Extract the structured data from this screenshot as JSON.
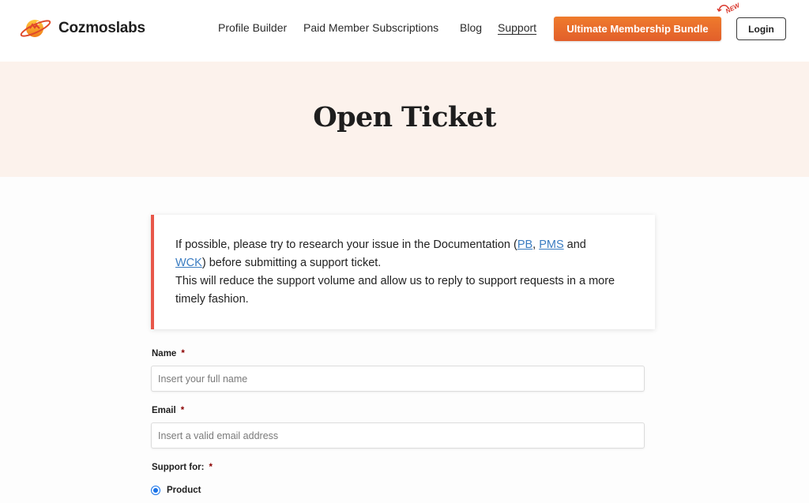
{
  "brand": {
    "name": "Cozmoslabs",
    "logo_icon": "planet-logo-icon"
  },
  "nav": {
    "items": [
      {
        "label": "Profile Builder",
        "active": false
      },
      {
        "label": "Paid Member Subscriptions",
        "active": false
      },
      {
        "label": "Blog",
        "active": false
      },
      {
        "label": "Support",
        "active": true
      }
    ],
    "cta_label": "Ultimate Membership Bundle",
    "new_badge": "NEW",
    "login_label": "Login"
  },
  "hero": {
    "title": "Open Ticket"
  },
  "notice": {
    "text_before": "If possible, please try to research your issue in the Documentation (",
    "link_pb": "PB",
    "sep1": ", ",
    "link_pms": "PMS",
    "sep2": " and ",
    "link_wck": "WCK",
    "text_after": ") before submitting a support ticket.",
    "line2": "This will reduce the support volume and allow us to reply to support requests in a more timely fashion."
  },
  "form": {
    "name": {
      "label": "Name",
      "required_mark": "*",
      "placeholder": "Insert your full name",
      "value": ""
    },
    "email": {
      "label": "Email",
      "required_mark": "*",
      "placeholder": "Insert a valid email address",
      "value": ""
    },
    "support_for": {
      "label": "Support for:",
      "required_mark": "*",
      "options": [
        {
          "label": "Product",
          "selected": true
        }
      ]
    }
  },
  "colors": {
    "accent": "#e8692b",
    "notice_border": "#e8574a",
    "link": "#3a7cc1",
    "hero_bg": "#fcf2ec",
    "radio": "#1a73e8"
  }
}
